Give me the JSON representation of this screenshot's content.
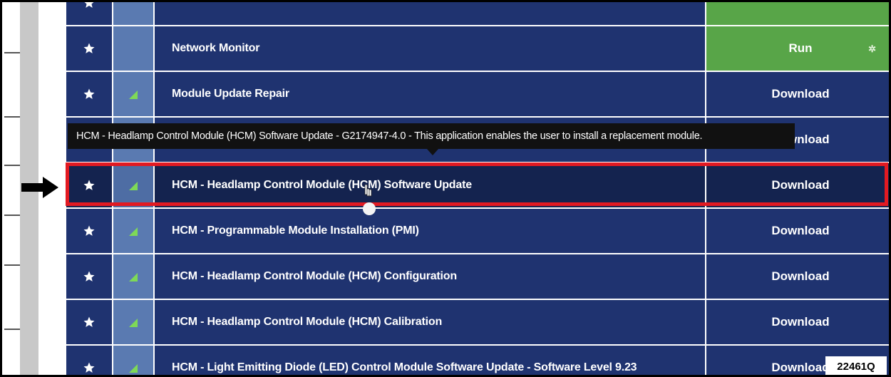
{
  "rows": [
    {
      "name": "",
      "action": "",
      "action_style": "run",
      "signal": false
    },
    {
      "name": "Network Monitor",
      "action": "Run",
      "action_style": "run",
      "signal": false
    },
    {
      "name": "Module Update Repair",
      "action": "Download",
      "action_style": "download",
      "signal": true
    },
    {
      "name": "",
      "action": "Download",
      "action_style": "download",
      "signal": true
    },
    {
      "name": "HCM - Headlamp Control Module (HCM) Software Update",
      "action": "Download",
      "action_style": "download",
      "signal": true,
      "highlighted": true
    },
    {
      "name": "HCM - Programmable Module Installation (PMI)",
      "action": "Download",
      "action_style": "download",
      "signal": true
    },
    {
      "name": "HCM - Headlamp Control Module (HCM) Configuration",
      "action": "Download",
      "action_style": "download",
      "signal": true
    },
    {
      "name": "HCM - Headlamp Control Module (HCM) Calibration",
      "action": "Download",
      "action_style": "download",
      "signal": true
    },
    {
      "name": "HCM - Light Emitting Diode (LED) Control Module Software Update - Software Level 9.23",
      "action": "Download",
      "action_style": "download",
      "signal": true
    }
  ],
  "tooltip": {
    "text": "HCM - Headlamp Control Module (HCM) Software Update - G2174947-4.0 - This application enables the user to install a replacement module."
  },
  "figure_label": "22461Q",
  "icons": {
    "favorite": "star-icon",
    "signal": "signal-bars-icon",
    "refresh": "refresh-icon",
    "pointer": "hand-cursor-icon",
    "callout": "arrow-right-icon"
  },
  "colors": {
    "row_bg": "#1f3370",
    "signal_cell_bg": "#5a7ab1",
    "run_bg": "#58a548",
    "highlight_border": "#e21a22",
    "tooltip_bg": "#111111"
  }
}
